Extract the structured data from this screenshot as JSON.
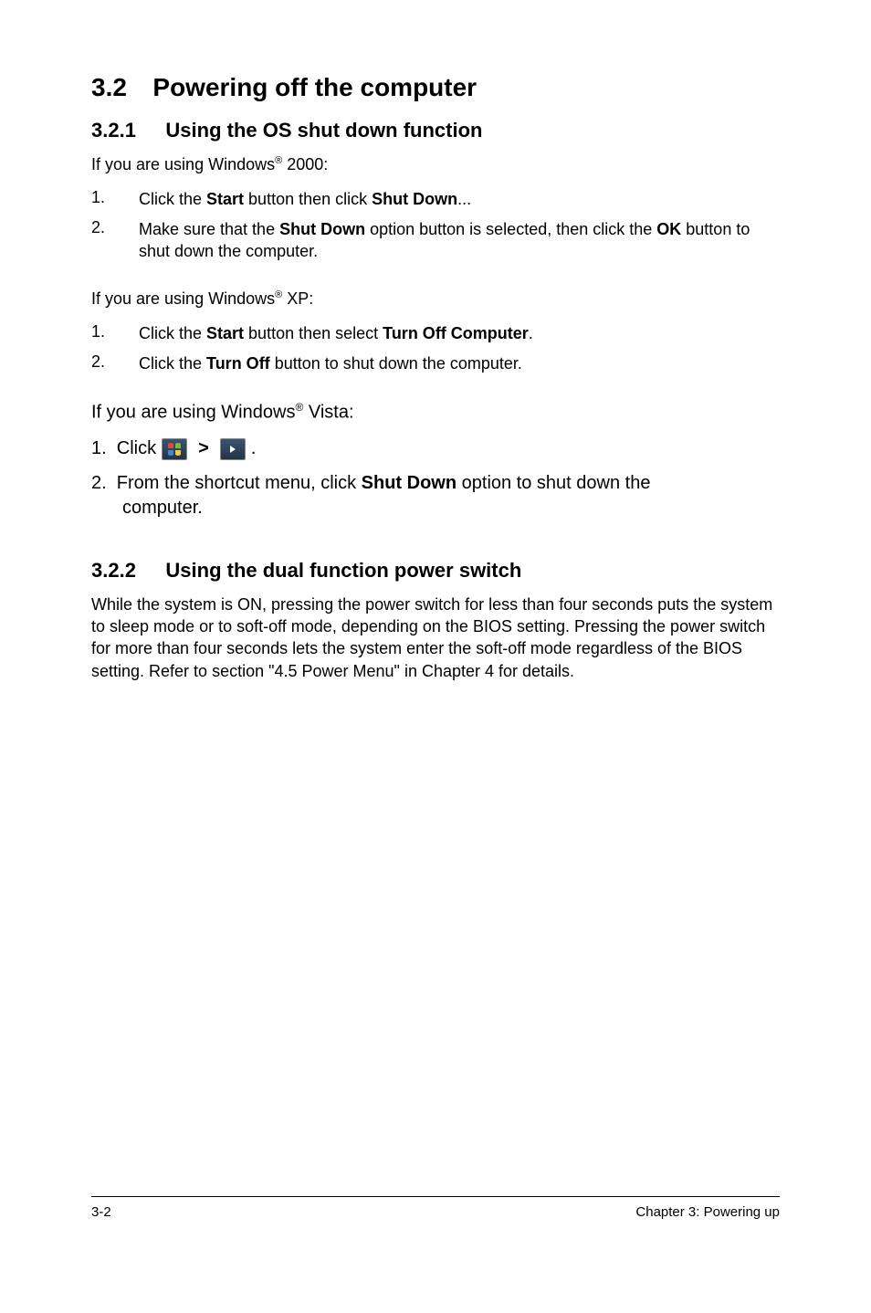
{
  "section": {
    "number": "3.2",
    "title": "Powering off the computer"
  },
  "sub1": {
    "number": "3.2.1",
    "title": "Using the OS shut down function",
    "intro_2000_pre": "If you are using Windows",
    "reg": "®",
    "intro_2000_post": " 2000:",
    "steps_2000": {
      "n1": "1.",
      "t1a": "Click the ",
      "t1_start": "Start",
      "t1b": " button then click ",
      "t1_shutdown": "Shut Down",
      "t1c": "...",
      "n2": "2.",
      "t2a": "Make sure that the ",
      "t2_shutdown": "Shut Down",
      "t2b": " option button is selected, then click the ",
      "t2_ok": "OK",
      "t2c": " button to shut down the computer."
    },
    "intro_xp_pre": "If you are using Windows",
    "intro_xp_post": " XP:",
    "steps_xp": {
      "n1": "1.",
      "t1a": "Click the ",
      "t1_start": "Start",
      "t1b": " button then select ",
      "t1_turnoff": "Turn Off Computer",
      "t1c": ".",
      "n2": "2.",
      "t2a": "Click the ",
      "t2_turnoff": "Turn Off",
      "t2b": " button to shut down the computer."
    },
    "intro_vista_pre": "If you are using Windows",
    "intro_vista_post": " Vista:",
    "vista": {
      "s1a": "1.  Click",
      "gt": ">",
      "dot": ".",
      "s2a": "2.  From the shortcut menu, click ",
      "s2_sd": "Shut Down",
      "s2b": " option to shut down the",
      "s2c": "computer."
    }
  },
  "sub2": {
    "number": "3.2.2",
    "title": "Using the dual function power switch",
    "para": "While the system is ON, pressing the power switch for less than four seconds puts the system to sleep mode or to soft-off mode, depending on the BIOS setting. Pressing the power switch for more than four seconds lets the system enter the soft-off mode regardless of the BIOS setting. Refer to section  \"4.5  Power Menu\" in Chapter 4 for details."
  },
  "footer": {
    "left": "3-2",
    "right": "Chapter 3: Powering up"
  }
}
